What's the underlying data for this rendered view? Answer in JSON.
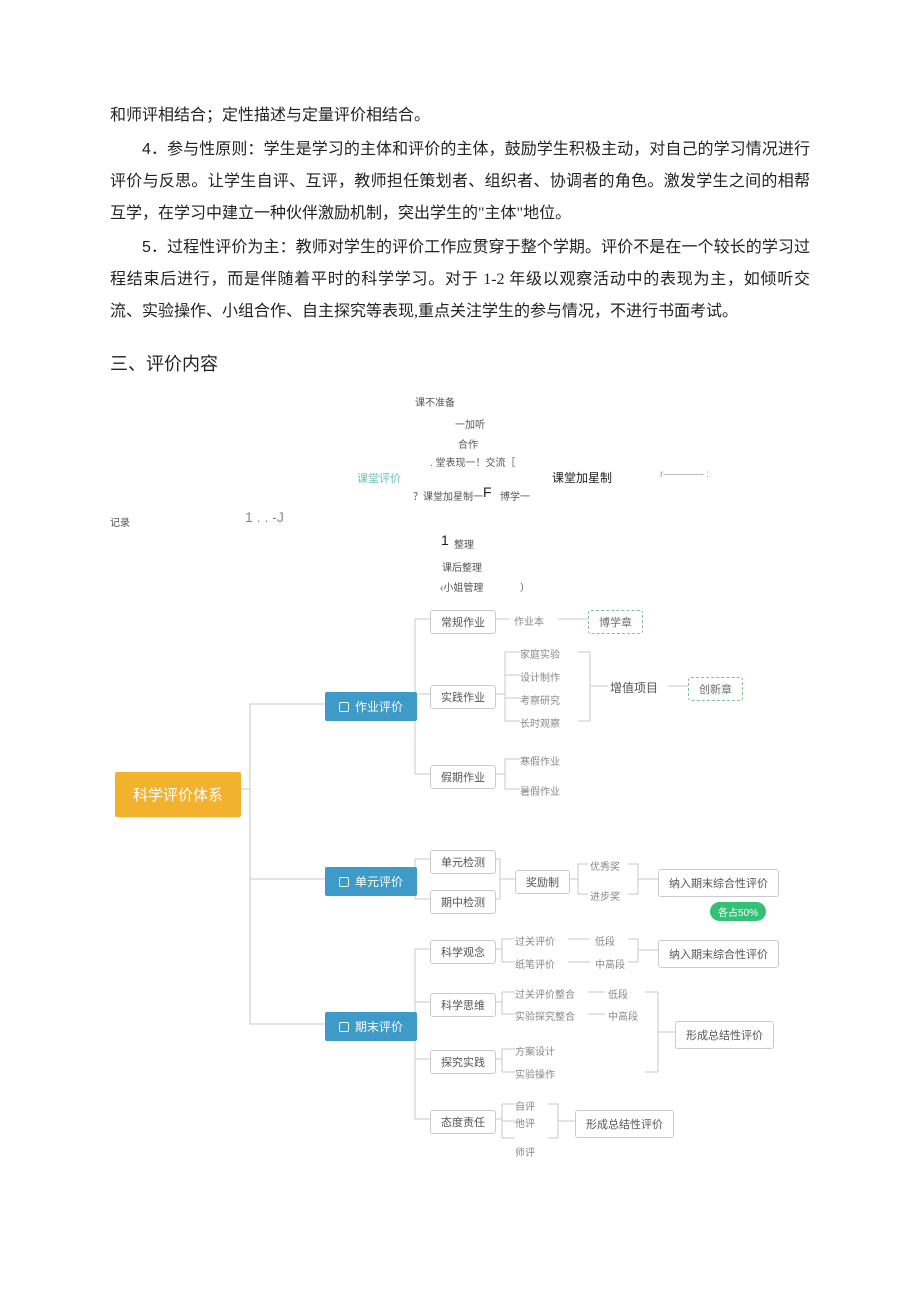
{
  "paragraphs": {
    "p0": "和师评相结合；定性描述与定量评价相结合。",
    "p4_num": "4",
    "p4": "．参与性原则：学生是学习的主体和评价的主体，鼓励学生积极主动，对自己的学习情况进行评价与反思。让学生自评、互评，教师担任策划者、组织者、协调者的角色。激发学生之间的相帮互学，在学习中建立一种伙伴激励机制，突出学生的\"主体\"地位。",
    "p5_num": "5",
    "p5": "．过程性评价为主：教师对学生的评价工作应贯穿于整个学期。评价不是在一个较长的学习过程结束后进行，而是伴随着平时的科学学习。对于 1-2 年级以观察活动中的表现为主，如倾听交流、实验操作、小组合作、自主探究等表现,重点关注学生的参与情况，不进行书面考试。"
  },
  "section_heading": "三、评价内容",
  "top_fragments": {
    "f1": "课不准备",
    "f2": "一加听",
    "f3": "合作",
    "f4": ". 堂表现一！交流［",
    "f5": "课堂评价",
    "f6": "课堂加星制",
    "f7": "r———— :",
    "f8": "？课堂加星制一",
    "f9": "F",
    "f10": "博学一",
    "f11": "记录",
    "f12": "1 . . -J",
    "f13": "1",
    "f14": "整理",
    "f15": "课后整理",
    "f16": "‹小姐管理",
    "f17": "）"
  },
  "root": "科学评价体系",
  "l2": {
    "homework": "作业评价",
    "unit": "单元评价",
    "final": "期末评价"
  },
  "homework": {
    "routine": "常规作业",
    "routine_leaf": "作业本",
    "routine_badge": "博学章",
    "practice": "实践作业",
    "practice_leaves": [
      "家庭实验",
      "设计制作",
      "考察研究",
      "长时观察"
    ],
    "vac": "假期作业",
    "vac_leaves": [
      "寒假作业",
      "暑假作业"
    ],
    "value_add": "增值项目",
    "value_badge": "创新章"
  },
  "unit": {
    "a": "单元检测",
    "b": "期中检测",
    "reward": "奖励制",
    "r_leaves": [
      "优秀奖",
      "进步奖"
    ],
    "result": "纳入期末综合性评价",
    "pill": "各占50%"
  },
  "final": {
    "concept": "科学观念",
    "concept_leaves": [
      "过关评价",
      "纸笔评价"
    ],
    "concept_tags": [
      "低段",
      "中高段"
    ],
    "concept_result": "纳入期末综合性评价",
    "think": "科学思维",
    "think_leaves": [
      "过关评价整合",
      "实验探究整合"
    ],
    "think_tags": [
      "低段",
      "中高段"
    ],
    "explore": "探究实践",
    "explore_leaves": [
      "方案设计",
      "实验操作"
    ],
    "middle_result": "形成总结性评价",
    "attitude": "态度责任",
    "att_leaves": [
      "自评",
      "他评",
      "师评"
    ],
    "att_result": "形成总结性评价"
  }
}
